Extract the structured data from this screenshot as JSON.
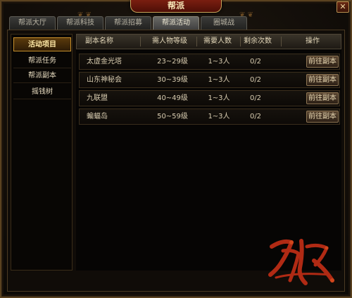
{
  "window": {
    "title": "帮派",
    "close_glyph": "✕"
  },
  "tabs": [
    {
      "label": "帮派大厅"
    },
    {
      "label": "帮派科技"
    },
    {
      "label": "帮派招募"
    },
    {
      "label": "帮派活动",
      "active": true
    },
    {
      "label": "圈城战"
    }
  ],
  "sidebar": {
    "items": [
      {
        "label": "活动项目",
        "active": true
      },
      {
        "label": "帮派任务"
      },
      {
        "label": "帮派副本"
      },
      {
        "label": "摇钱树"
      }
    ]
  },
  "table": {
    "headers": [
      "副本名称",
      "需人物等级",
      "需要人数",
      "剩余次数",
      "操作"
    ],
    "rows": [
      {
        "name": "太虚金光塔",
        "level": "23~29级",
        "people": "1~3人",
        "remaining": "0/2",
        "action": "前往副本"
      },
      {
        "name": "山东神秘会",
        "level": "30~39级",
        "people": "1~3人",
        "remaining": "0/2",
        "action": "前往副本"
      },
      {
        "name": "九联盟",
        "level": "40~49级",
        "people": "1~3人",
        "remaining": "0/2",
        "action": "前往副本"
      },
      {
        "name": "蝙蝠岛",
        "level": "50~59级",
        "people": "1~3人",
        "remaining": "0/2",
        "action": "前往副本"
      }
    ]
  },
  "colors": {
    "accent": "#c8902c",
    "title_bg": "#7a1e10",
    "emblem": "#b02a14"
  },
  "emblem_icon": "guild-calligraphy-emblem"
}
